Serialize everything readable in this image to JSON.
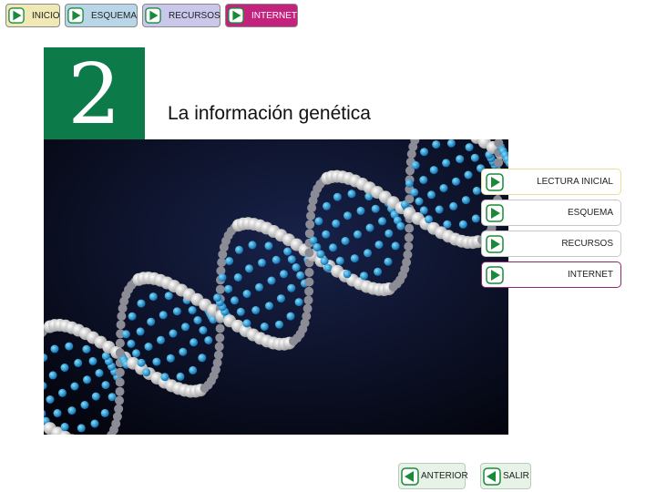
{
  "topnav": {
    "items": [
      {
        "label": "INICIO",
        "icon": "play-icon"
      },
      {
        "label": "ESQUEMA",
        "icon": "play-icon"
      },
      {
        "label": "RECURSOS",
        "icon": "play-icon"
      },
      {
        "label": "INTERNET",
        "icon": "play-icon"
      }
    ]
  },
  "chapter": {
    "number": "2"
  },
  "page": {
    "title": "La información genética"
  },
  "side_menu": {
    "items": [
      {
        "label": "LECTURA INICIAL",
        "icon": "play-icon"
      },
      {
        "label": "ESQUEMA",
        "icon": "play-icon"
      },
      {
        "label": "RECURSOS",
        "icon": "play-icon"
      },
      {
        "label": "INTERNET",
        "icon": "play-icon"
      }
    ]
  },
  "bottom_nav": {
    "previous_label": "ANTERIOR",
    "exit_label": "SALIR"
  },
  "image": {
    "subject": "dna-molecule-model"
  },
  "colors": {
    "chapter_green": "#0d7a4a",
    "icon_green": "#1a8a3a",
    "internet_magenta": "#c4237d",
    "button_green_bg": "#e6f3e6"
  }
}
